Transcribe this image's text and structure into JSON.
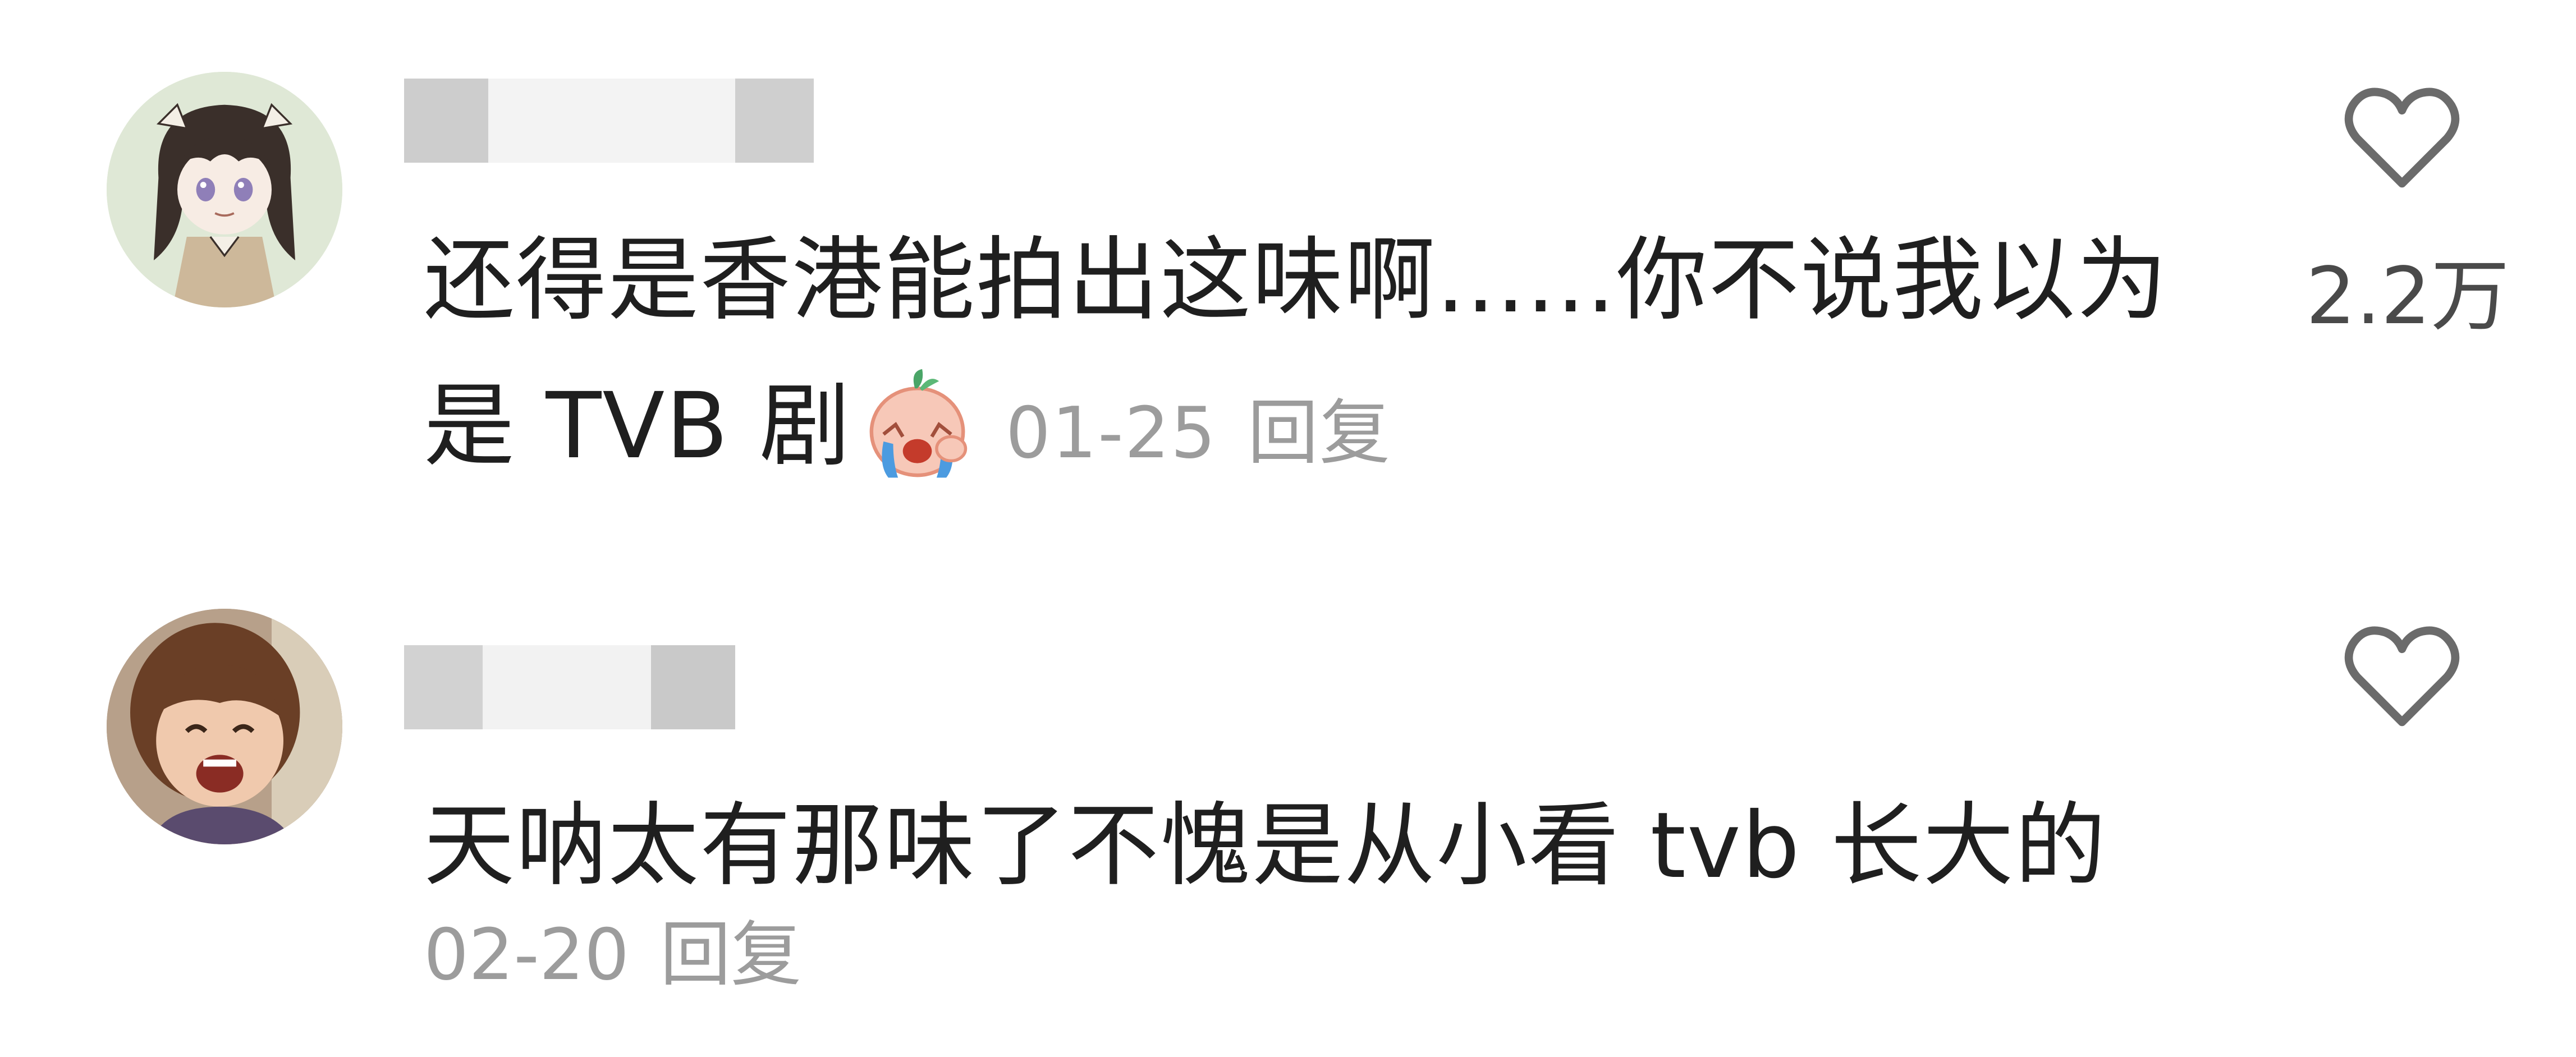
{
  "comments": [
    {
      "text": "还得是香港能拍出这味啊......你不说我以为是 TVB 剧",
      "emoji": "crying-laughing-sticker-icon",
      "date": "01-25",
      "reply_label": "回复",
      "like_count": "2.2万",
      "avatar": "anime-girl-avatar"
    },
    {
      "text": "天呐太有那味了不愧是从小看 tvb 长大的",
      "date": "02-20",
      "reply_label": "回复",
      "like_count": "",
      "avatar": "laughing-child-avatar"
    }
  ],
  "colors": {
    "text": "#1f1f1f",
    "meta": "#9c9c9c",
    "like_count": "#4a4a4a",
    "heart_outline": "#6b6b6b"
  }
}
